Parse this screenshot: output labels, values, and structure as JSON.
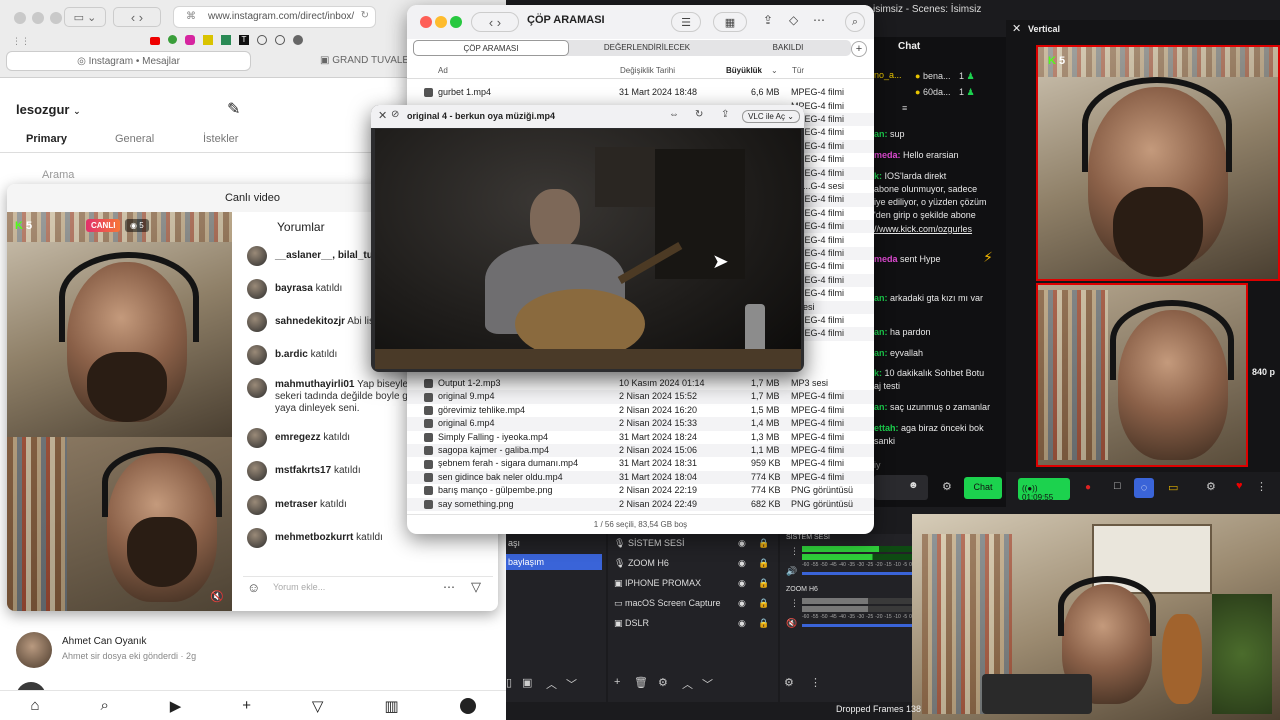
{
  "browser": {
    "url": "www.instagram.com/direct/inbox/",
    "tab1": "Instagram • Mesajlar",
    "tab2": "GRAND TUVALET"
  },
  "instagram": {
    "username": "lesozgur",
    "tabs": [
      "Primary",
      "General",
      "İstekler"
    ],
    "search_placeholder": "Arama",
    "dm": {
      "name": "Ahmet Can Oyanık",
      "preview": "Ahmet sir dosya eki gönderdi · 2g"
    }
  },
  "live": {
    "title": "Canlı video",
    "badge_live": "CANLI",
    "viewers": "5",
    "kick_count": "5",
    "comments_title": "Yorumlar",
    "comment_placeholder": "Yorum ekle...",
    "comments": [
      {
        "user": "__aslaner__, bilal_tur",
        "text": ""
      },
      {
        "user": "bayrasa",
        "text": "katıldı"
      },
      {
        "user": "sahnedekitozjr",
        "text": "Abi lisa"
      },
      {
        "user": "b.ardic",
        "text": "katıldı"
      },
      {
        "user": "mahmuthayirli01",
        "text": "Yap biseyler sekeri tadında değilde boyle ge yaya dinleyek seni."
      },
      {
        "user": "emregezz",
        "text": "katıldı"
      },
      {
        "user": "mstfakrts17",
        "text": "katıldı"
      },
      {
        "user": "metraser",
        "text": "katıldı"
      },
      {
        "user": "mehmetbozkurrt",
        "text": "katıldı"
      }
    ]
  },
  "finder": {
    "title": "ÇÖP ARAMASI",
    "tabs": [
      "ÇÖP ARAMASI",
      "DEĞERLENDİRİLECEK",
      "BAKILDI"
    ],
    "cols": [
      "Ad",
      "Değişiklik Tarihi",
      "Büyüklük",
      "Tür"
    ],
    "rows": [
      [
        "gurbet 1.mp4",
        "31 Mart 2024 18:48",
        "6,6 MB",
        "MPEG-4 filmi"
      ],
      [
        "Output 1-2.mp3",
        "10 Kasım 2024 01:14",
        "1,7 MB",
        "MP3 sesi"
      ],
      [
        "original 9.mp4",
        "2 Nisan 2024 15:52",
        "1,7 MB",
        "MPEG-4 filmi"
      ],
      [
        "görevimiz tehlike.mp4",
        "2 Nisan 2024 16:20",
        "1,5 MB",
        "MPEG-4 filmi"
      ],
      [
        "original 6.mp4",
        "2 Nisan 2024 15:33",
        "1,4 MB",
        "MPEG-4 filmi"
      ],
      [
        "Simply Falling - iyeoka.mp4",
        "31 Mart 2024 18:24",
        "1,3 MB",
        "MPEG-4 filmi"
      ],
      [
        "sagopa kajmer - galiba.mp4",
        "2 Nisan 2024 15:06",
        "1,1 MB",
        "MPEG-4 filmi"
      ],
      [
        "şebnem ferah - sigara dumanı.mp4",
        "31 Mart 2024 18:31",
        "959 KB",
        "MPEG-4 filmi"
      ],
      [
        "sen gidince bak neler oldu.mp4",
        "31 Mart 2024 18:04",
        "774 KB",
        "MPEG-4 filmi"
      ],
      [
        "barış manço - gülpembe.png",
        "2 Nisan 2024 22:19",
        "774 KB",
        "PNG görüntüsü"
      ],
      [
        "say something.png",
        "2 Nisan 2024 22:49",
        "682 KB",
        "PNG görüntüsü"
      ]
    ],
    "hidden_kinds": [
      "MPEG-4 filmi",
      "MPEG-4 filmi",
      "MPEG-4 filmi",
      "MPEG-4 filmi",
      "MPEG-4 filmi",
      "MPEG-4 filmi",
      "ble...G-4 sesi",
      "MPEG-4 filmi",
      "MPEG-4 filmi",
      "MPEG-4 filmi",
      "MPEG-4 filmi",
      "MPEG-4 filmi",
      "MPEG-4 filmi",
      "MPEG-4 filmi",
      "MPEG-4 filmi",
      "3 sesi",
      "MPEG-4 filmi",
      "MPEG-4 filmi"
    ],
    "status": "1 / 56 seçili, 83,54 GB boş"
  },
  "vlc": {
    "title": "original 4 - berkun oya müziği.mp4",
    "open_button": "VLC ile Aç"
  },
  "obs": {
    "titlebar": "isimsiz - Scenes: İsimsiz",
    "chat_title": "Chat",
    "vertical_title": "Vertical",
    "kick_count": "5",
    "chat_users": [
      {
        "name": "no_a...",
        "count": ""
      },
      {
        "name": "bena...",
        "count": "1"
      },
      {
        "name": "60da...",
        "count": "1"
      }
    ],
    "chat": [
      {
        "user": "an:",
        "text": "sup"
      },
      {
        "user": "meda:",
        "text": "Hello erarsian"
      },
      {
        "user": "k:",
        "text": "IOS'larda direkt"
      },
      {
        "user": "",
        "text": "abone olunmuyor, sadece"
      },
      {
        "user": "",
        "text": "iye ediliyor, o yüzden çözüm"
      },
      {
        "user": "",
        "text": "'den girip o şekilde abone"
      },
      {
        "user": "",
        "text": "//www.kick.com/ozgurles"
      },
      {
        "user": "meda",
        "text": "sent Hype"
      },
      {
        "user": "an:",
        "text": "arkadaki gta kızı mı var"
      },
      {
        "user": "an:",
        "text": "ha pardon"
      },
      {
        "user": "an:",
        "text": "eyvallah"
      },
      {
        "user": "k:",
        "text": "10 dakikalık Sohbet Botu"
      },
      {
        "user": "",
        "text": "aj testi"
      },
      {
        "user": "an:",
        "text": "saç uzunmuş o zamanlar"
      },
      {
        "user": "ettah:",
        "text": "aga biraz önceki bok"
      },
      {
        "user": "",
        "text": "sanki"
      }
    ],
    "chat_input_hint": "iy",
    "chat_button": "Chat",
    "timer": "01:09:55",
    "res_label": "840 p",
    "scene_items": [
      "aşı",
      "baylaşım"
    ],
    "sources": [
      "SİSTEM SESİ",
      "ZOOM H6",
      "IPHONE PROMAX",
      "macOS Screen Capture",
      "DSLR"
    ],
    "mixer_labels": [
      "SİSTEM SESİ",
      "ZOOM H6"
    ],
    "meter_scale": [
      "-60",
      "-55",
      "-50",
      "-45",
      "-40",
      "-35",
      "-30",
      "-25",
      "-20",
      "-15",
      "-10",
      "-5",
      "0"
    ],
    "footer": "Dropped Frames 138"
  },
  "colors": {
    "kick_green": "#53fc18",
    "obs_green": "#1cd24e",
    "finder_blue": "#0a64d8",
    "live_red": "#e1306c",
    "obs_blue": "#3a64d8"
  }
}
